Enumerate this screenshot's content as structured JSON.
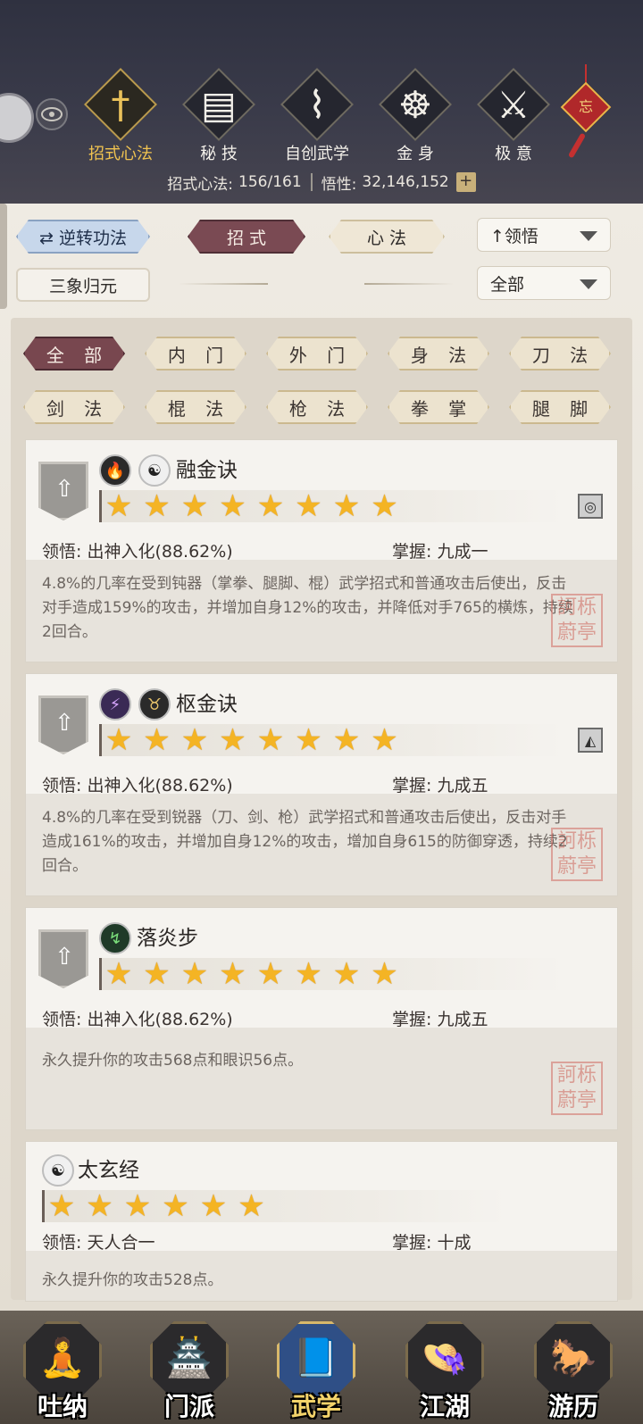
{
  "top_nav": {
    "items": [
      {
        "label": "招式心法",
        "icon": "sword-icon",
        "glyph": "†",
        "active": true
      },
      {
        "label": "秘 技",
        "icon": "book-icon",
        "glyph": "▤",
        "active": false
      },
      {
        "label": "自创武学",
        "icon": "scroll-icon",
        "glyph": "⌇",
        "active": false
      },
      {
        "label": "金 身",
        "icon": "meditation-icon",
        "glyph": "☸",
        "active": false
      },
      {
        "label": "极 意",
        "icon": "martial-pose-icon",
        "glyph": "⚔",
        "active": false
      }
    ],
    "knot_text": "忘"
  },
  "stats": {
    "moves_label": "招式心法:",
    "moves_value": "156/161",
    "insight_label": "悟性:",
    "insight_value": "32,146,152",
    "plus": "+"
  },
  "controls": {
    "reverse": "⇄ 逆转功法",
    "tab_moves": "招 式",
    "tab_mind": "心 法",
    "sort_dropdown": "↑领悟",
    "triple": "三象归元",
    "filter_dropdown": "全部"
  },
  "filters": [
    "全 部",
    "内 门",
    "外 门",
    "身 法",
    "刀 法",
    "剑 法",
    "棍 法",
    "枪 法",
    "拳 掌",
    "腿 脚"
  ],
  "cards": [
    {
      "icons": [
        "🔥",
        "☯"
      ],
      "title": "融金诀",
      "stars": 8,
      "sq_icon": "◎",
      "insight": "领悟:  出神入化(88.62%)",
      "mastery": "掌握:  九成一",
      "desc": "4.8%的几率在受到钝器（掌拳、腿脚、棍）武学招式和普通攻击后使出，反击对手造成159%的攻击，并增加自身12%的攻击，并降低对手765的横炼，持续2回合。"
    },
    {
      "icons": [
        "⚡",
        "♉"
      ],
      "title": "枢金诀",
      "stars": 8,
      "sq_icon": "◭",
      "insight": "领悟:  出神入化(88.62%)",
      "mastery": "掌握:  九成五",
      "desc": "4.8%的几率在受到锐器（刀、剑、枪）武学招式和普通攻击后使出，反击对手造成161%的攻击，并增加自身12%的攻击，增加自身615的防御穿透，持续2回合。"
    },
    {
      "icons": [
        "↯"
      ],
      "title": "落炎步",
      "stars": 8,
      "insight": "领悟:  出神入化(88.62%)",
      "mastery": "掌握:  九成五",
      "desc": "永久提升你的攻击568点和眼识56点。"
    },
    {
      "icons": [
        "☯"
      ],
      "title": "太玄经",
      "stars": 6,
      "insight": "领悟:  天人合一",
      "mastery": "掌握:  十成",
      "desc": "永久提升你的攻击528点。"
    }
  ],
  "seal_text": "訶栎蔚亭",
  "bottom_nav": [
    {
      "label": "吐纳",
      "icon": "monk-icon",
      "pic": "🧘",
      "active": false
    },
    {
      "label": "门派",
      "icon": "sect-banner-icon",
      "pic": "🏯",
      "active": false
    },
    {
      "label": "武学",
      "icon": "martial-book-icon",
      "pic": "📘",
      "active": true
    },
    {
      "label": "江湖",
      "icon": "straw-hat-icon",
      "pic": "👒",
      "active": false
    },
    {
      "label": "游历",
      "icon": "horse-icon",
      "pic": "🐎",
      "active": false
    }
  ],
  "colors": {
    "header_bg": "#2f3140",
    "active_gold": "#f0c350",
    "selected_tab": "#7a4a53",
    "star": "#f4b424"
  }
}
